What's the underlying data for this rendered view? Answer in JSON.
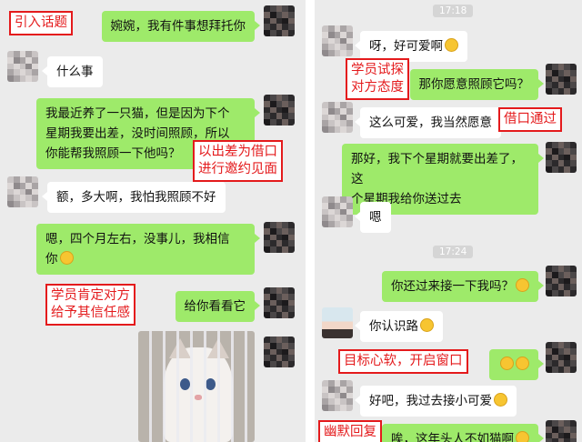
{
  "colors": {
    "annotation": "#e41a1c",
    "bubble_self": "#9eea6a",
    "bubble_other": "#ffffff",
    "chat_bg": "#ebebeb"
  },
  "left": {
    "messages": [
      {
        "from": "self",
        "text": "婉婉，我有件事想拜托你"
      },
      {
        "from": "other",
        "text": "什么事"
      },
      {
        "from": "self",
        "lines": [
          "我最近养了一只猫，但是因为下个",
          "星期我要出差，没时间照顾，所以",
          "你能帮我照顾一下他吗？"
        ]
      },
      {
        "from": "other",
        "text": "额，多大啊，我怕我照顾不好"
      },
      {
        "from": "self",
        "lines": [
          "嗯，四个月左右，没事儿，我相信",
          "你"
        ]
      },
      {
        "from": "self",
        "text": "给你看看它"
      }
    ],
    "photo": {
      "subject": "kitten-photo"
    },
    "annotations": [
      {
        "lines": [
          "引入话题"
        ]
      },
      {
        "lines": [
          "以出差为借口",
          "进行邀约见面"
        ]
      },
      {
        "lines": [
          "学员肯定对方",
          "给予其信任感"
        ]
      }
    ]
  },
  "right": {
    "times": [
      "17:18",
      "17:24"
    ],
    "messages": [
      {
        "from": "other",
        "text": "呀，好可爱啊"
      },
      {
        "from": "self",
        "text": "那你愿意照顾它吗？"
      },
      {
        "from": "other",
        "text": "这么可爱，我当然愿意"
      },
      {
        "from": "self",
        "lines": [
          "那好，我下个星期就要出差了，这",
          "个星期我给你送过去"
        ]
      },
      {
        "from": "other",
        "text": "嗯"
      },
      {
        "from": "self",
        "text": "你还过来接一下我吗？"
      },
      {
        "from": "other",
        "text": "你认识路"
      },
      {
        "from": "self",
        "text": ""
      },
      {
        "from": "other",
        "text": "好吧，我过去接小可爱"
      },
      {
        "from": "other",
        "text": "唉，这年头人不如猫啊"
      }
    ],
    "annotations": [
      {
        "lines": [
          "学员试探",
          "对方态度"
        ]
      },
      {
        "lines": [
          "借口通过"
        ]
      },
      {
        "lines": [
          "目标心软，开启窗口"
        ]
      },
      {
        "lines": [
          "幽默回复"
        ]
      }
    ]
  }
}
